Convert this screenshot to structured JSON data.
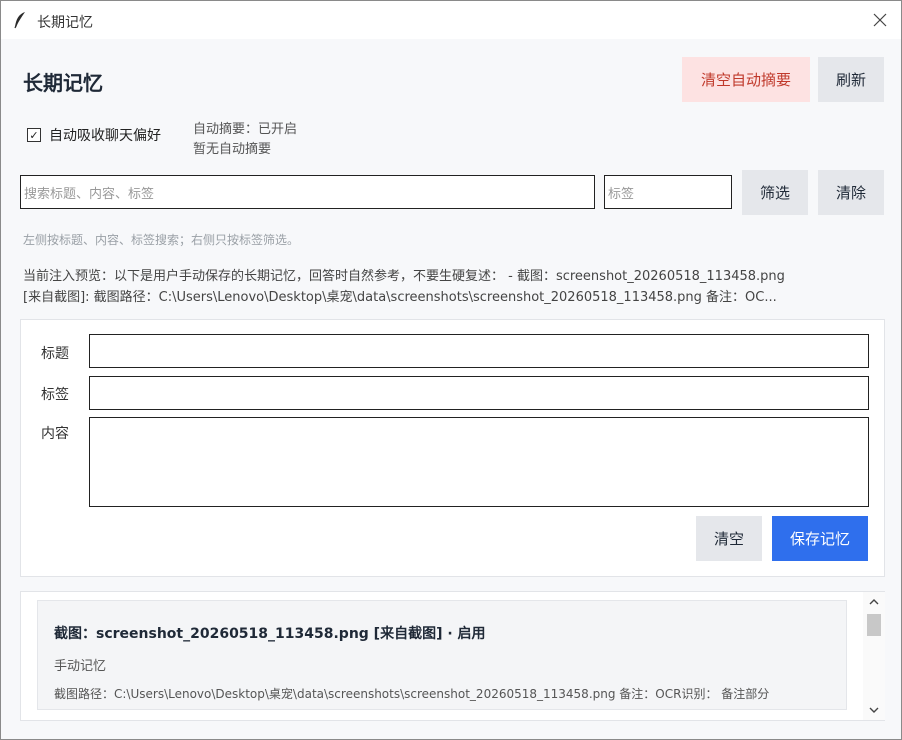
{
  "window": {
    "title": "长期记忆"
  },
  "header": {
    "title": "长期记忆",
    "clear_auto_summary_label": "清空自动摘要",
    "refresh_label": "刷新"
  },
  "auto_absorb": {
    "label": "自动吸收聊天偏好",
    "checked": true,
    "check_mark": "✓"
  },
  "status": {
    "auto_summary": "自动摘要：已开启",
    "no_summary": "暂无自动摘要"
  },
  "search": {
    "placeholder": "搜索标题、内容、标签",
    "tag_placeholder": "标签",
    "filter_label": "筛选",
    "clear_label": "清除",
    "hint": "左侧按标题、内容、标签搜索；右侧只按标签筛选。"
  },
  "preview": {
    "line1": "当前注入预览：以下是用户手动保存的长期记忆，回答时自然参考，不要生硬复述： - 截图：screenshot_20260518_113458.png",
    "line2": "[来自截图]: 截图路径：C:\\Users\\Lenovo\\Desktop\\桌宠\\data\\screenshots\\screenshot_20260518_113458.png 备注：OC..."
  },
  "form": {
    "title_label": "标题",
    "tags_label": "标签",
    "content_label": "内容",
    "title_value": "",
    "tags_value": "",
    "content_value": "",
    "clear_label": "清空",
    "save_label": "保存记忆"
  },
  "memory_list": {
    "items": [
      {
        "title": "截图：screenshot_20260518_113458.png  [来自截图] · 启用",
        "type": "手动记忆",
        "detail": "截图路径：C:\\Users\\Lenovo\\Desktop\\桌宠\\data\\screenshots\\screenshot_20260518_113458.png 备注：OCR识别： 备注部分"
      }
    ]
  },
  "colors": {
    "primary": "#2f6fed",
    "danger_bg": "#fde2e2",
    "danger_text": "#c0392b",
    "neutral_button": "#e5e7eb"
  },
  "icons": {
    "app": "feather-icon",
    "close": "close-icon",
    "scroll_up": "chevron-up-icon",
    "scroll_down": "chevron-down-icon"
  }
}
